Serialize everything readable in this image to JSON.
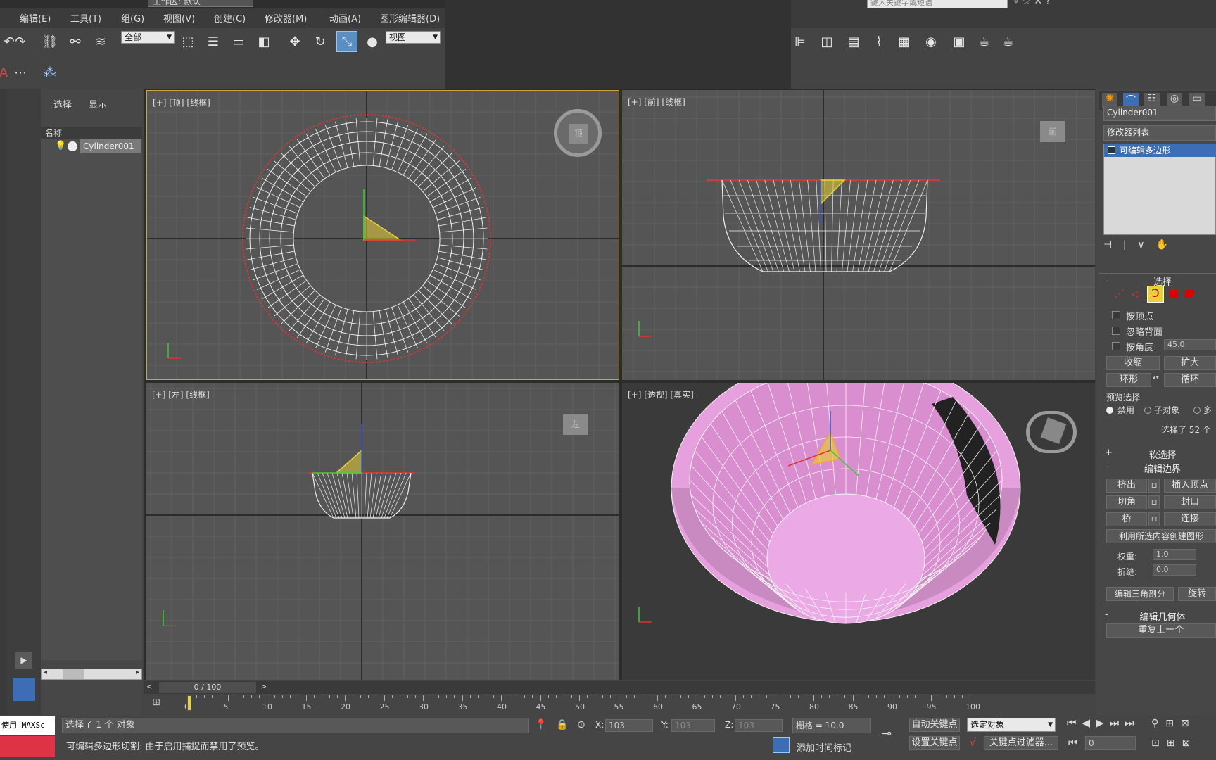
{
  "menu": {
    "workspace": "工作区: 默认",
    "items": [
      "编辑(E)",
      "工具(T)",
      "组(G)",
      "视图(V)",
      "创建(C)",
      "修改器(M)",
      "动画(A)",
      "图形编辑器(D)"
    ],
    "search_placeholder": "键入关键字或短语"
  },
  "toolbar": {
    "selection_filter": "全部",
    "ref_coord": "视图",
    "active_tool": "select-and-scale"
  },
  "scene_explorer": {
    "tabs": [
      "选择",
      "显示"
    ],
    "column_header": "名称",
    "items": [
      {
        "name": "Cylinder001"
      }
    ]
  },
  "viewports": {
    "top": {
      "label": "[+] [顶] [线框]",
      "viewcube_face": "顶"
    },
    "front": {
      "label": "[+] [前] [线框]",
      "viewcube_face": "前"
    },
    "left": {
      "label": "[+] [左] [线框]",
      "viewcube_face": "左"
    },
    "perspective": {
      "label": "[+] [透视] [真实]"
    }
  },
  "command_panel": {
    "object_name": "Cylinder001",
    "modifier_list": "修改器列表",
    "stack_item": "可编辑多边形",
    "selection": {
      "title": "选择",
      "by_vertex": "按顶点",
      "ignore_backfacing": "忽略背面",
      "by_angle": "按角度:",
      "angle_value": "45.0",
      "shrink": "收缩",
      "grow": "扩大",
      "ring": "环形",
      "loop": "循环",
      "preview_label": "预览选择",
      "preview_options": [
        "禁用",
        "子对象",
        "多"
      ],
      "status": "选择了 52 个"
    },
    "soft_selection": "软选择",
    "edit_borders": {
      "title": "编辑边界",
      "extrude": "挤出",
      "insert_vertex": "插入顶点",
      "chamfer": "切角",
      "cap": "封口",
      "bridge": "桥",
      "connect": "连接",
      "create_shape": "利用所选内容创建图形",
      "weight_label": "权重:",
      "weight_value": "1.0",
      "crease_label": "折缝:",
      "crease_value": "0.0",
      "edit_tri": "编辑三角剖分",
      "turn": "旋转"
    },
    "edit_geometry": {
      "title": "编辑几何体",
      "repeat_last": "重复上一个"
    }
  },
  "timeline": {
    "frame_counter": "0 / 100",
    "ticks": [
      "0",
      "5",
      "10",
      "15",
      "20",
      "25",
      "30",
      "35",
      "40",
      "45",
      "50",
      "55",
      "60",
      "65",
      "70",
      "75",
      "80",
      "85",
      "90",
      "95",
      "100"
    ]
  },
  "status": {
    "maxscript": "使用 MAXSc",
    "line1": "选择了 1 个 对象",
    "line2": "可编辑多边形切割: 由于启用捕捉而禁用了预览。",
    "x_label": "X:",
    "x_value": "103",
    "y_label": "Y:",
    "y_value": "103",
    "z_label": "Z:",
    "z_value": "103",
    "grid": "栅格 = 10.0",
    "auto_key": "自动关键点",
    "set_key": "设置关键点",
    "key_mode": "选定对象",
    "key_filters": "关键点过滤器...",
    "add_time_tag": "添加时间标记",
    "current_frame": "0"
  },
  "colors": {
    "accent_blue": "#3d6db5",
    "selected_yellow": "#e8d23a",
    "bowl_pink": "#e6a0de",
    "active_viewport_border": "#c8a83c"
  }
}
